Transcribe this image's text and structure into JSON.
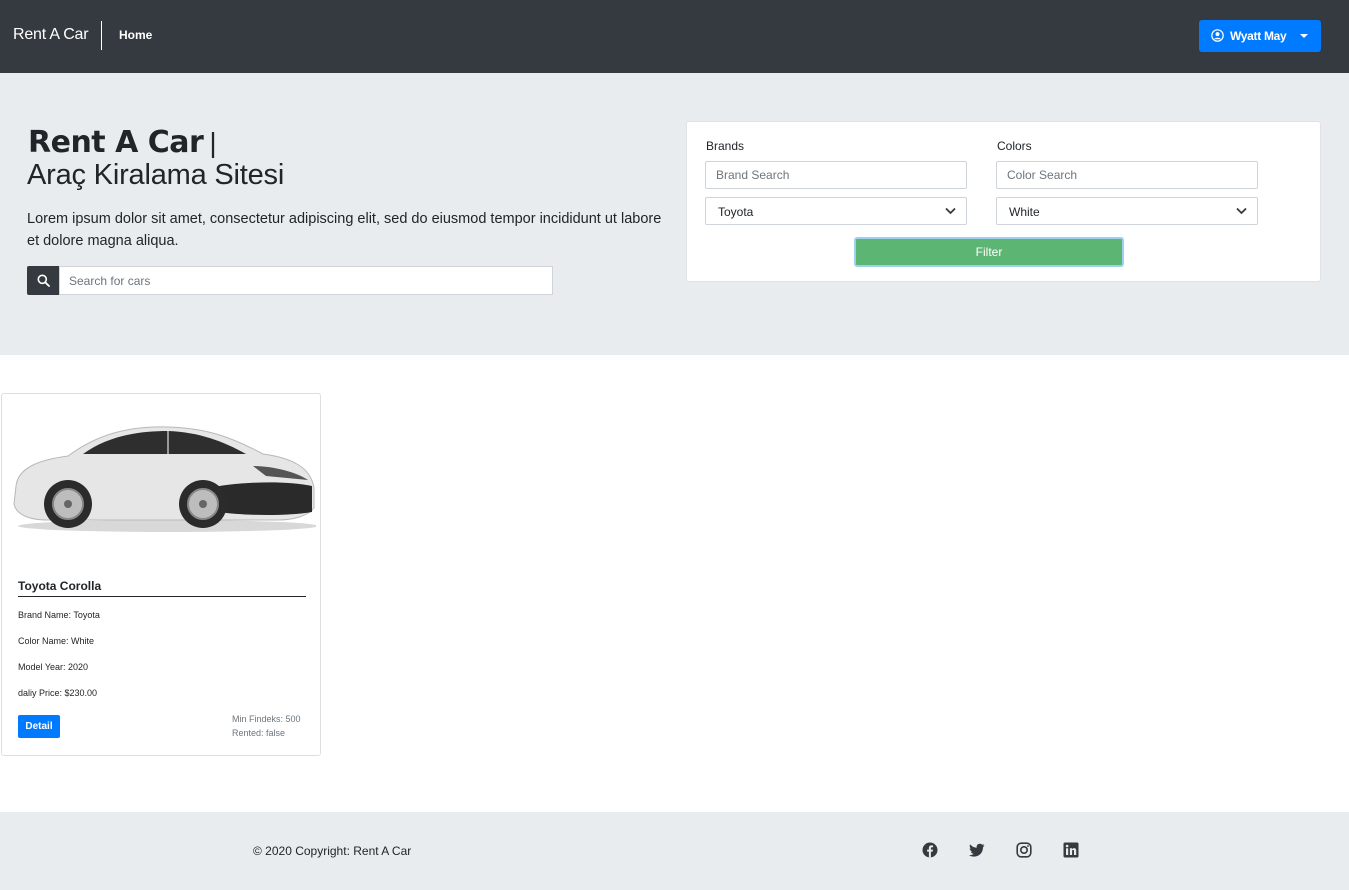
{
  "navbar": {
    "brand": "Rent A Car",
    "home_label": "Home",
    "user_name": "Wyatt May"
  },
  "hero": {
    "title_bold": "Rent A Car",
    "title_separator": "|",
    "subtitle": "Araç Kiralama Sitesi",
    "text": "Lorem ipsum dolor sit amet, consectetur adipiscing elit, sed do eiusmod tempor incididunt ut labore et dolore magna aliqua.",
    "search_placeholder": "Search for cars"
  },
  "filter": {
    "brands_label": "Brands",
    "brand_search_placeholder": "Brand Search",
    "brand_selected": "Toyota",
    "colors_label": "Colors",
    "color_search_placeholder": "Color Search",
    "color_selected": "White",
    "filter_button": "Filter"
  },
  "cars": [
    {
      "name": "Toyota Corolla",
      "brand_line": "Brand Name: Toyota",
      "color_line": "Color Name: White",
      "model_line": "Model Year: 2020",
      "price_line": "daliy Price: $230.00",
      "detail_button": "Detail",
      "findeks_line": "Min Findeks: 500",
      "rented_line": "Rented: false"
    }
  ],
  "footer": {
    "copyright": "© 2020 Copyright: Rent A Car",
    "social_icons": [
      "facebook-icon",
      "twitter-icon",
      "instagram-icon",
      "linkedin-icon"
    ]
  },
  "colors": {
    "navbar": "#343a40",
    "primary": "#007bff",
    "filter_button": "#5cb573",
    "hero_background": "#e9ecef"
  }
}
